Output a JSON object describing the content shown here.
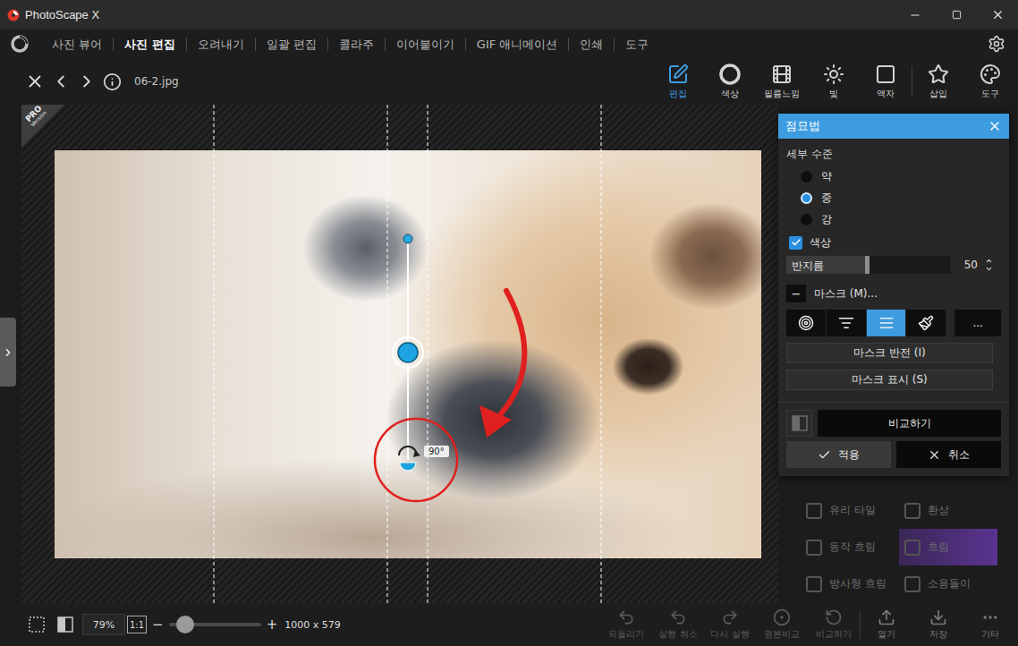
{
  "window": {
    "title": "PhotoScape X"
  },
  "menu": [
    {
      "label": "사진 뷰어",
      "selected": false
    },
    {
      "label": "사진 편집",
      "selected": true
    },
    {
      "label": "오려내기",
      "selected": false
    },
    {
      "label": "일괄 편집",
      "selected": false
    },
    {
      "label": "콜라주",
      "selected": false
    },
    {
      "label": "이어붙이기",
      "selected": false
    },
    {
      "label": "GIF 애니메이션",
      "selected": false
    },
    {
      "label": "인쇄",
      "selected": false
    },
    {
      "label": "도구",
      "selected": false
    }
  ],
  "toolbar": {
    "filename": "06-2.jpg",
    "tools": [
      {
        "label": "편집",
        "selected": true
      },
      {
        "label": "색상",
        "selected": false
      },
      {
        "label": "필름느낌",
        "selected": false
      },
      {
        "label": "빛",
        "selected": false
      },
      {
        "label": "액자",
        "selected": false
      },
      {
        "label": "삽입",
        "selected": false
      },
      {
        "label": "도구",
        "selected": false
      }
    ]
  },
  "badge": {
    "line1": "PRO",
    "line2": "Version"
  },
  "canvas": {
    "rotation_label": "90°"
  },
  "filters": [
    {
      "label": "유리 타일",
      "selected": false
    },
    {
      "label": "환상",
      "selected": false
    },
    {
      "label": "동작 흐림",
      "selected": false
    },
    {
      "label": "흐림",
      "selected": true
    },
    {
      "label": "방사형 흐림",
      "selected": false
    },
    {
      "label": "소용돌이",
      "selected": false
    }
  ],
  "panel": {
    "title": "점묘법",
    "detail_label": "세부 수준",
    "detail_options": [
      {
        "label": "약",
        "selected": false
      },
      {
        "label": "중",
        "selected": true
      },
      {
        "label": "강",
        "selected": false
      }
    ],
    "color_option": {
      "label": "색상",
      "checked": true
    },
    "radius": {
      "label": "반지름",
      "level": 0.49,
      "reading": "50"
    },
    "mask": {
      "toggle": "−",
      "label": "마스크 (M)...",
      "modes": [
        {
          "selected": false
        },
        {
          "selected": false
        },
        {
          "selected": true
        },
        {
          "selected": false
        }
      ],
      "more": "...",
      "invert": "마스크 반전 (I)",
      "show": "마스크 표시 (S)"
    },
    "compare": "비교하기",
    "apply": "적용",
    "cancel": "취소"
  },
  "status_bar": {
    "zoom": "79%",
    "actual_size": "1:1",
    "zoom_minus": "−",
    "zoom_plus": "+",
    "zoom_level": 0.18,
    "dimensions": "1000 x 579",
    "actions": [
      {
        "label": "되돌리기",
        "disabled": true
      },
      {
        "label": "실행 취소",
        "disabled": true
      },
      {
        "label": "다시 실행",
        "disabled": true
      },
      {
        "label": "원본비교",
        "disabled": true
      },
      {
        "label": "비교하기",
        "disabled": true
      },
      {
        "label": "열기",
        "disabled": false
      },
      {
        "label": "저장",
        "disabled": false
      },
      {
        "label": "기타",
        "disabled": false
      }
    ]
  }
}
